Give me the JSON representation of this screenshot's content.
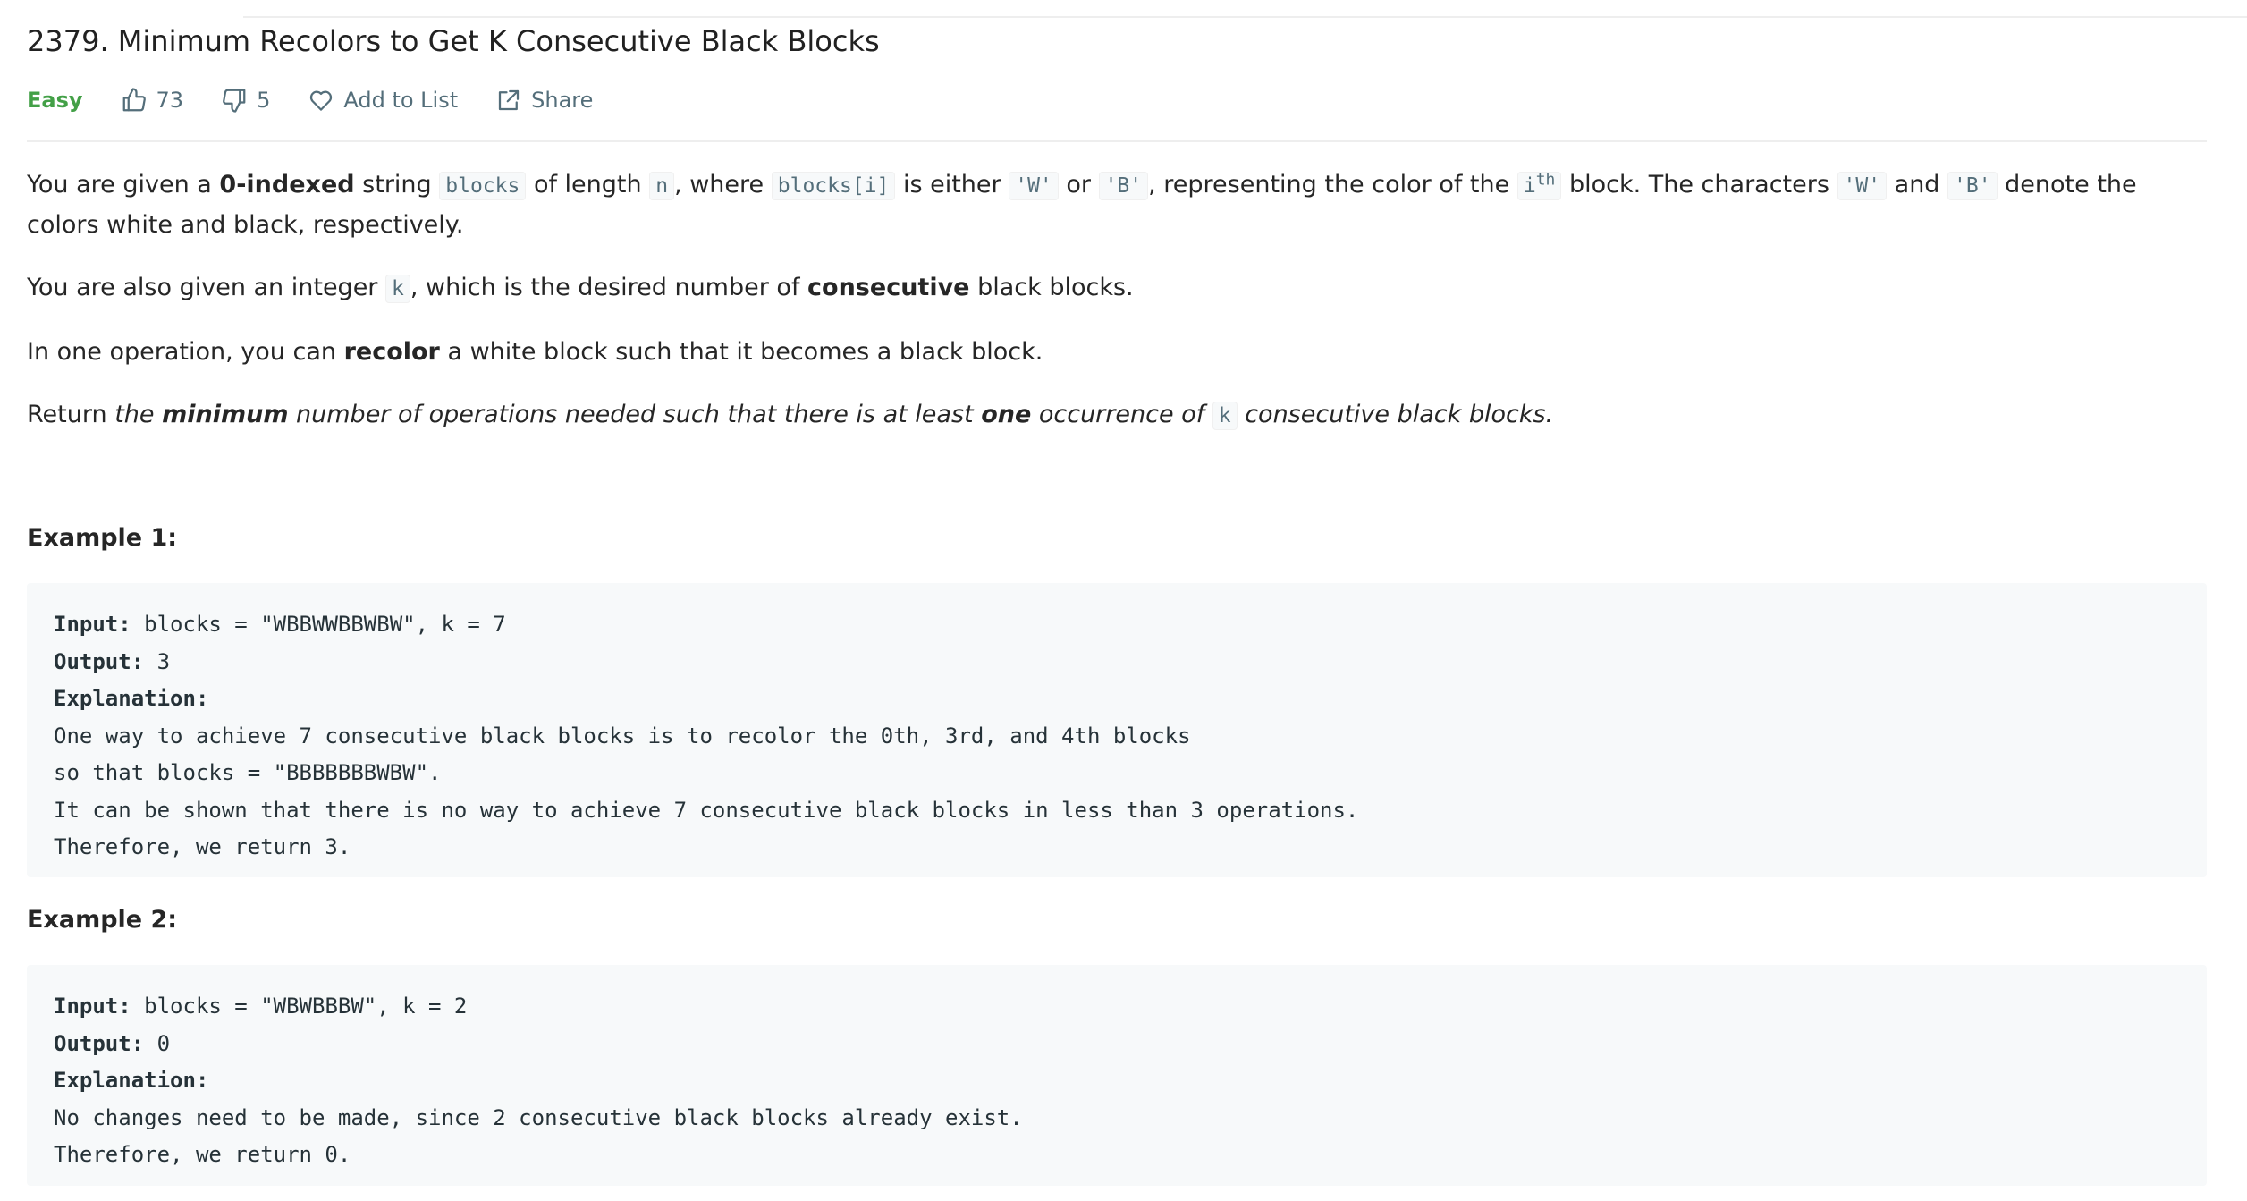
{
  "problem": {
    "title": "2379. Minimum Recolors to Get K Consecutive Black Blocks",
    "difficulty": "Easy",
    "likes": "73",
    "dislikes": "5",
    "add_to_list_label": "Add to List",
    "share_label": "Share"
  },
  "description": {
    "p1": {
      "t1": "You are given a ",
      "b1": "0-indexed",
      "t2": " string ",
      "c1": "blocks",
      "t3": " of length ",
      "c2": "n",
      "t4": ", where ",
      "c3": "blocks[i]",
      "t5": " is either ",
      "c4": "'W'",
      "t6": " or ",
      "c5": "'B'",
      "t7": ", representing the color of the ",
      "c6": "i",
      "sup": "th",
      "t8": " block. The characters ",
      "c7": "'W'",
      "t9": " and ",
      "c8": "'B'",
      "t10": " denote the colors white and black, respectively."
    },
    "p2": {
      "t1": "You are also given an integer ",
      "c1": "k",
      "t2": ", which is the desired number of ",
      "b1": "consecutive",
      "t3": " black blocks."
    },
    "p3": {
      "t1": "In one operation, you can ",
      "b1": "recolor",
      "t2": " a white block such that it becomes a black block."
    },
    "p4": {
      "t1": "Return ",
      "i1": "the ",
      "bi1": "minimum",
      "i2": " number of operations needed such that there is at least ",
      "bi2": "one",
      "i3": " occurrence of ",
      "c1": "k",
      "i4": " consecutive black blocks."
    }
  },
  "examples": [
    {
      "title": "Example 1:",
      "input_label": "Input:",
      "input_value": " blocks = \"WBBWWBBWBW\", k = 7",
      "output_label": "Output:",
      "output_value": " 3",
      "explanation_label": "Explanation:",
      "explanation_lines": [
        "One way to achieve 7 consecutive black blocks is to recolor the 0th, 3rd, and 4th blocks",
        "so that blocks = \"BBBBBBBWBW\".",
        "It can be shown that there is no way to achieve 7 consecutive black blocks in less than 3 operations.",
        "Therefore, we return 3."
      ]
    },
    {
      "title": "Example 2:",
      "input_label": "Input:",
      "input_value": " blocks = \"WBWBBBW\", k = 2",
      "output_label": "Output:",
      "output_value": " 0",
      "explanation_label": "Explanation:",
      "explanation_lines": [
        "No changes need to be made, since 2 consecutive black blocks already exist.",
        "Therefore, we return 0."
      ]
    }
  ],
  "colors": {
    "easy": "#43a047",
    "meta_gray": "#546e7a",
    "code_bg": "#f7f9fa"
  },
  "icons": {
    "like": "thumbs-up-icon",
    "dislike": "thumbs-down-icon",
    "add_to_list": "heart-icon",
    "share": "share-icon"
  }
}
